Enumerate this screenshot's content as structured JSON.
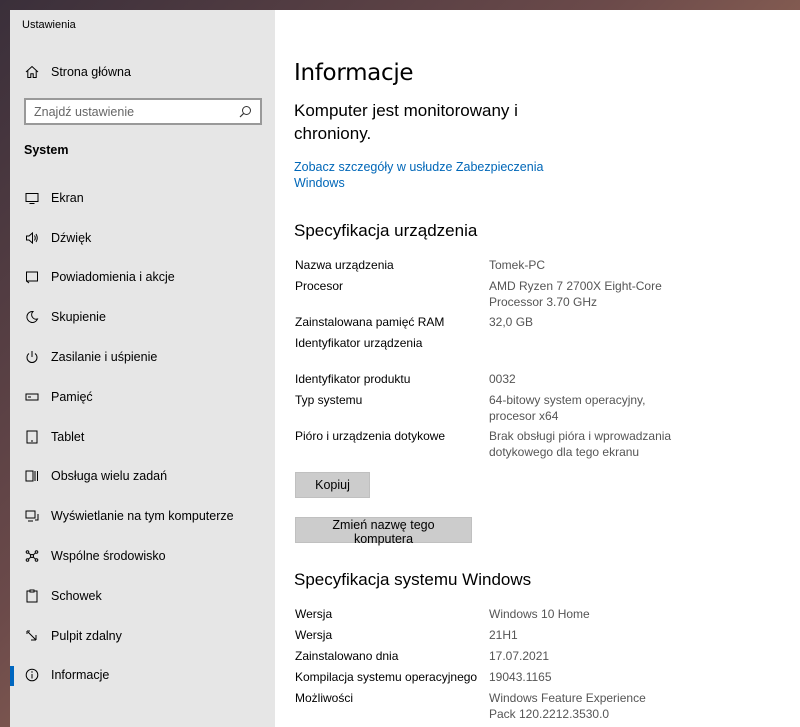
{
  "window": {
    "app_title": "Ustawienia"
  },
  "sidebar": {
    "home_label": "Strona główna",
    "search_placeholder": "Znajdź ustawienie",
    "section_title": "System",
    "items": [
      {
        "label": "Ekran",
        "icon": "display-icon"
      },
      {
        "label": "Dźwięk",
        "icon": "speaker-icon"
      },
      {
        "label": "Powiadomienia i akcje",
        "icon": "notification-icon"
      },
      {
        "label": "Skupienie",
        "icon": "moon-icon"
      },
      {
        "label": "Zasilanie i uśpienie",
        "icon": "power-icon"
      },
      {
        "label": "Pamięć",
        "icon": "storage-icon"
      },
      {
        "label": "Tablet",
        "icon": "tablet-icon"
      },
      {
        "label": "Obsługa wielu zadań",
        "icon": "multitasking-icon"
      },
      {
        "label": "Wyświetlanie na tym komputerze",
        "icon": "projecting-icon"
      },
      {
        "label": "Wspólne środowisko",
        "icon": "shared-experiences-icon"
      },
      {
        "label": "Schowek",
        "icon": "clipboard-icon"
      },
      {
        "label": "Pulpit zdalny",
        "icon": "remote-desktop-icon"
      },
      {
        "label": "Informacje",
        "icon": "info-icon",
        "active": true
      }
    ]
  },
  "main": {
    "title": "Informacje",
    "protection_text": "Komputer jest monitorowany i chroniony.",
    "security_link": "Zobacz szczegóły w usłudze Zabezpieczenia Windows",
    "device_spec": {
      "heading": "Specyfikacja urządzenia",
      "rows": [
        {
          "key": "Nazwa urządzenia",
          "value": "Tomek-PC"
        },
        {
          "key": "Procesor",
          "value": "AMD Ryzen 7 2700X Eight-Core Processor 3.70 GHz"
        },
        {
          "key": "Zainstalowana pamięć RAM",
          "value": "32,0 GB"
        },
        {
          "key": "Identyfikator urządzenia",
          "value": ""
        },
        {
          "key": "Identyfikator produktu",
          "value": "0032"
        },
        {
          "key": "Typ systemu",
          "value": "64-bitowy system operacyjny, procesor x64"
        },
        {
          "key": "Pióro i urządzenia dotykowe",
          "value": "Brak obsługi pióra i wprowadzania dotykowego dla tego ekranu"
        }
      ],
      "copy_button": "Kopiuj",
      "rename_button": "Zmień nazwę tego komputera"
    },
    "windows_spec": {
      "heading": "Specyfikacja systemu Windows",
      "rows": [
        {
          "key": "Wersja",
          "value": "Windows 10 Home"
        },
        {
          "key": "Wersja",
          "value": "21H1"
        },
        {
          "key": "Zainstalowano dnia",
          "value": "17.07.2021"
        },
        {
          "key": "Kompilacja systemu operacyjnego",
          "value": "19043.1165"
        },
        {
          "key": "Możliwości",
          "value": "Windows Feature Experience Pack 120.2212.3530.0"
        }
      ]
    }
  }
}
